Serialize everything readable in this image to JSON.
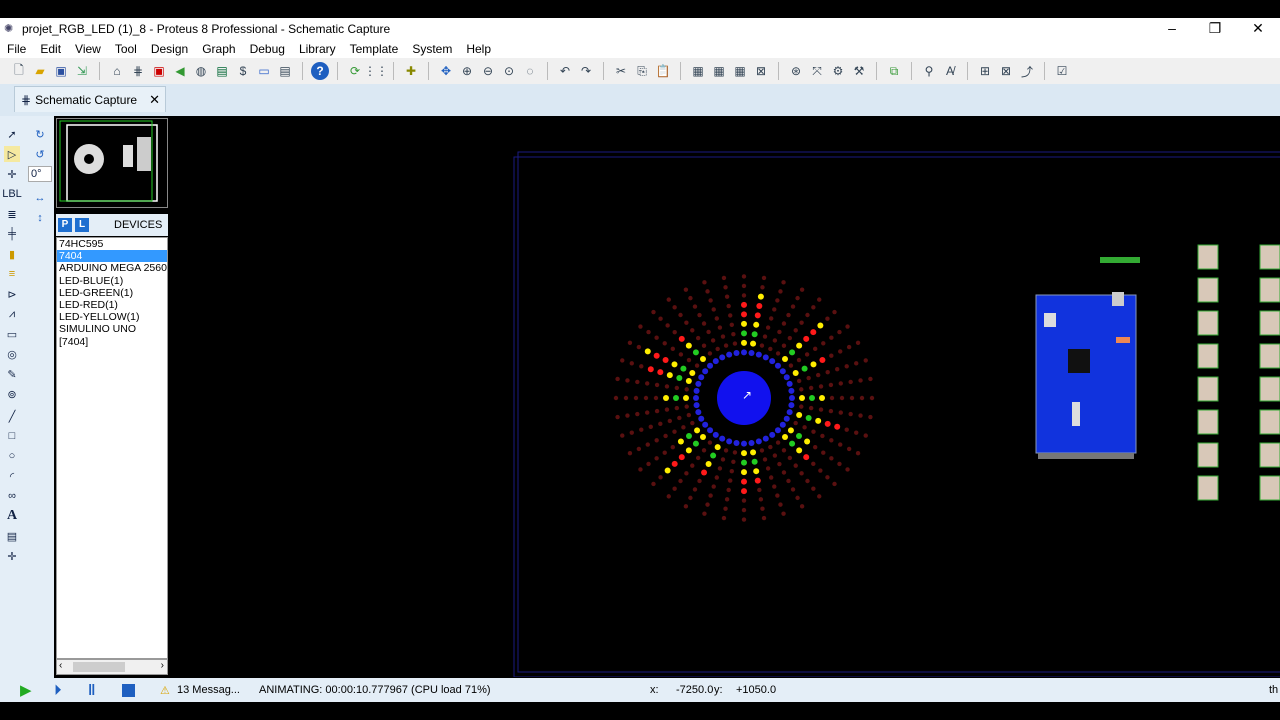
{
  "window": {
    "title": "projet_RGB_LED (1)_8 - Proteus 8 Professional - Schematic Capture",
    "min": "–",
    "max": "❐",
    "close": "✕"
  },
  "menu": [
    "File",
    "Edit",
    "View",
    "Tool",
    "Design",
    "Graph",
    "Debug",
    "Library",
    "Template",
    "System",
    "Help"
  ],
  "tab": {
    "label": "Schematic Capture",
    "close": "✕"
  },
  "rotation": "0°",
  "devices": {
    "p": "P",
    "l": "L",
    "header": "DEVICES",
    "items": [
      "74HC595",
      "7404",
      "ARDUINO MEGA 2560",
      "LED-BLUE(1)",
      "LED-GREEN(1)",
      "LED-RED(1)",
      "LED-YELLOW(1)",
      "SIMULINO UNO",
      "[7404]"
    ],
    "selected": 1
  },
  "status": {
    "messages": "13 Messag...",
    "animating": "ANIMATING: 00:00:10.777967 (CPU load 71%)",
    "x_label": "x:",
    "x": "-7250.0",
    "y_label": "y:",
    "y": "+1050.0",
    "trail": "th"
  },
  "colors": {
    "red": "#ff1a1a",
    "green": "#22cc22",
    "yellow": "#ffee00",
    "blue": "#2222dd",
    "off": "#5a1010",
    "board": "#1133dd"
  }
}
